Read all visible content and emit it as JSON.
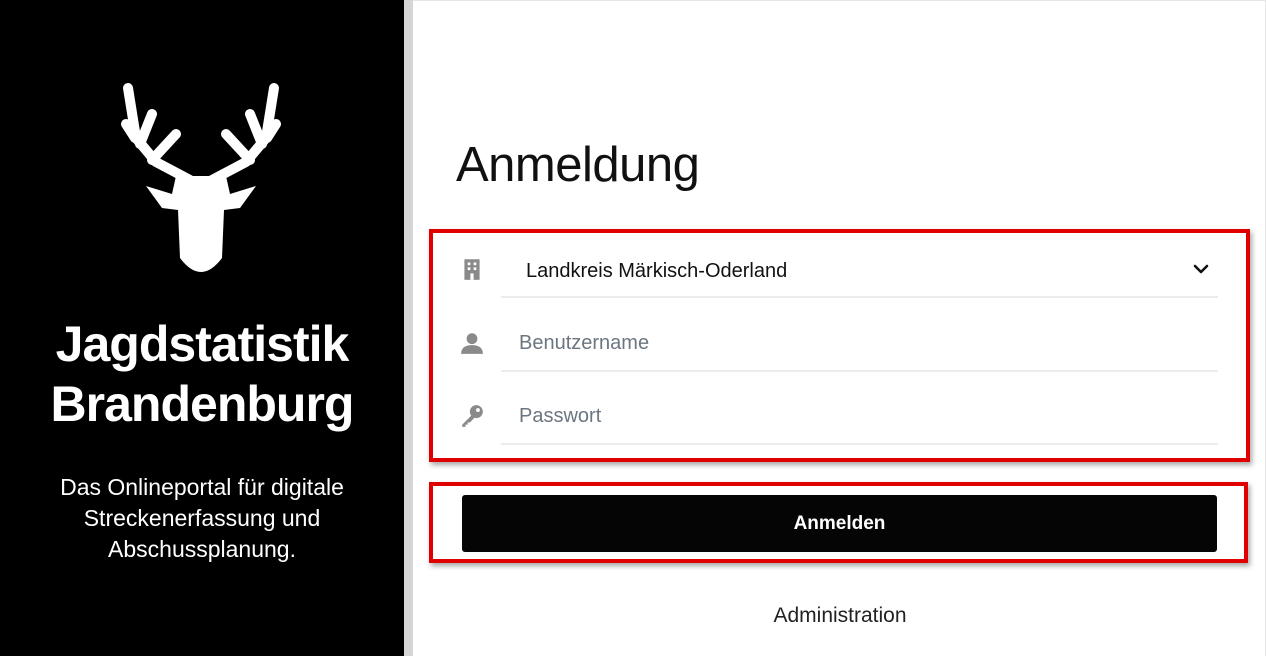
{
  "brand": {
    "title_line1": "Jagdstatistik",
    "title_line2": "Brandenburg",
    "subtitle": "Das Onlineportal für digitale Streckenerfassung und Abschussplanung."
  },
  "login": {
    "title": "Anmeldung",
    "district_select": {
      "value": "Landkreis Märkisch-Oderland",
      "icon": "building-icon"
    },
    "username": {
      "placeholder": "Benutzername",
      "icon": "user-icon"
    },
    "password": {
      "placeholder": "Passwort",
      "icon": "key-icon"
    },
    "submit_label": "Anmelden",
    "admin_link": "Administration"
  },
  "colors": {
    "left_panel": "#000000",
    "highlight": "#e10000",
    "button": "#050505",
    "icon": "#8a8a8a"
  }
}
